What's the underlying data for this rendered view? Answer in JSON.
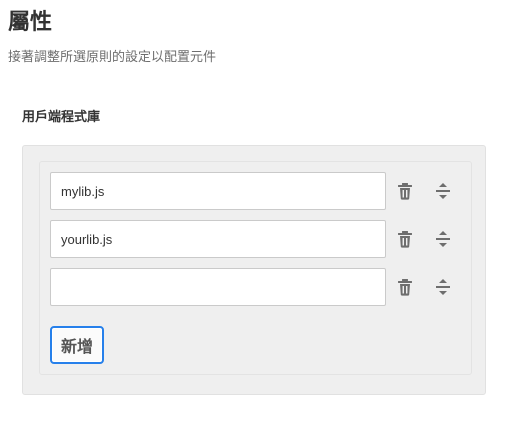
{
  "header": {
    "title": "屬性",
    "subtitle": "接著調整所選原則的設定以配置元件"
  },
  "client_library": {
    "label": "用戶端程式庫",
    "items": [
      {
        "value": "mylib.js",
        "delete_icon": "trash-icon",
        "reorder_icon": "drag-handle-icon"
      },
      {
        "value": "yourlib.js",
        "delete_icon": "trash-icon",
        "reorder_icon": "drag-handle-icon"
      },
      {
        "value": "",
        "delete_icon": "trash-icon",
        "reorder_icon": "drag-handle-icon"
      }
    ],
    "add_label": "新增"
  },
  "colors": {
    "accent": "#2680eb",
    "panel_background": "#efefef",
    "icon": "#6e6e6e"
  }
}
